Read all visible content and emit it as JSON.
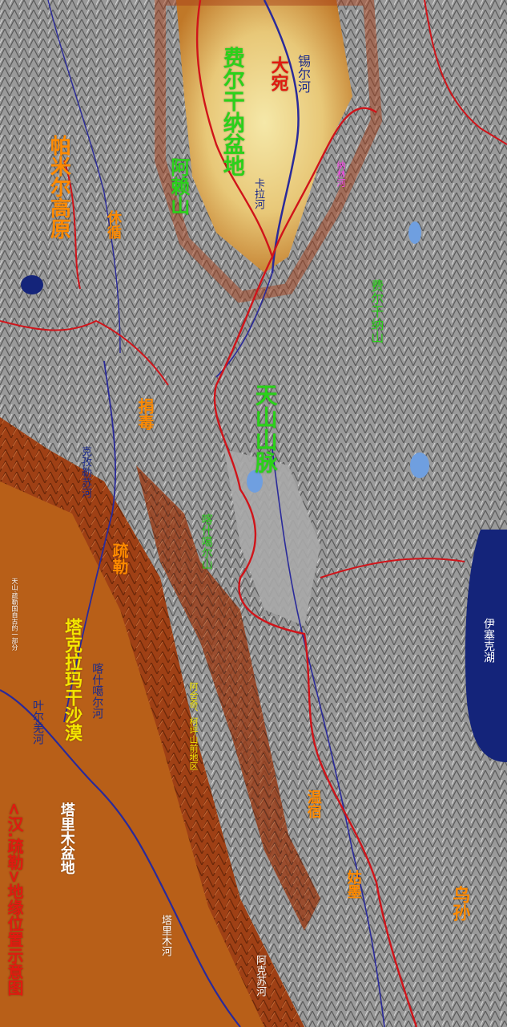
{
  "title": "<汉.疏勒>地缘位置示意图",
  "lake": "伊塞克湖",
  "regions": {
    "ferghana": "费尔干纳盆地",
    "dayuan": "大宛",
    "pamir": "帕米尔高原",
    "taklamakan": "塔克拉玛干沙漠",
    "tarim": "塔里木盆地",
    "aheqi": "阿合奇、柯坪山前地区"
  },
  "mountains": {
    "alai": "阿赖山",
    "tianshan": "天山山脉",
    "ferghana_range": "费尔干纳山",
    "kashgar_range": "喀什噶尔山"
  },
  "states": {
    "shule": "疏勒",
    "juanchu": "捐毒",
    "xiuxun": "休循",
    "wensu": "温宿",
    "gumo": "姑墨",
    "wusun": "乌孙"
  },
  "rivers": {
    "syr": "锡尔河",
    "kara": "卡拉河",
    "kashgar": "喀什噶尔河",
    "yarkand": "叶尔羌河",
    "tarim": "塔里木河",
    "kezile": "克孜勒苏河",
    "aksu": "阿克苏河"
  },
  "small_labels": {
    "naryn": "纳林河",
    "kashi_note": "天山·疏勒国自古的一部分"
  },
  "colors": {
    "water": "#14247a",
    "boundary": "#d0141a",
    "river": "#2a2a9a"
  }
}
